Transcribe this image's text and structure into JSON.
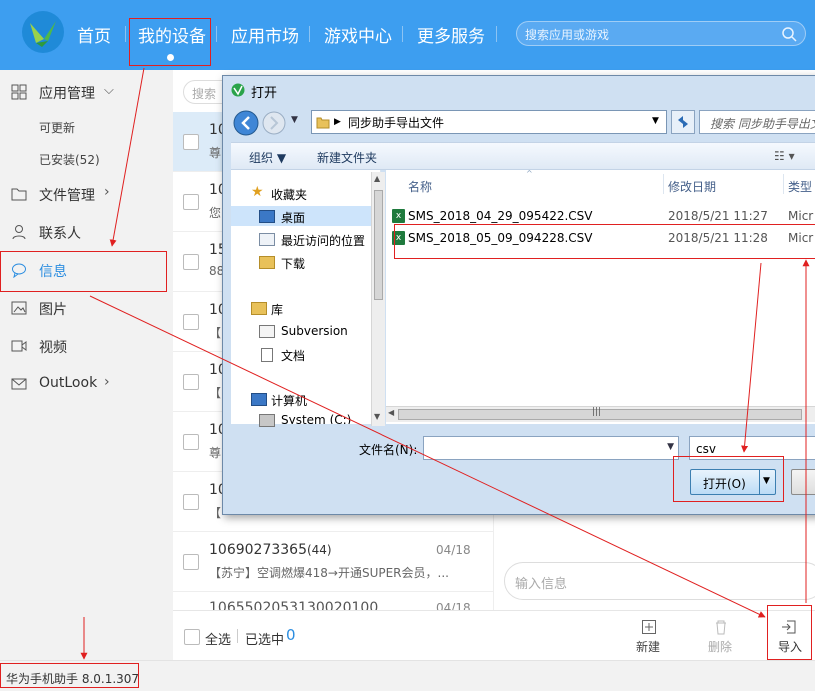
{
  "topnav": {
    "items": [
      "首页",
      "我的设备",
      "应用市场",
      "游戏中心",
      "更多服务"
    ],
    "search_placeholder": "搜索应用或游戏"
  },
  "sidebar": {
    "app_mgmt": "应用管理",
    "updatable": "可更新",
    "installed": "已安装(52)",
    "file_mgmt": "文件管理",
    "contacts": "联系人",
    "messages": "信息",
    "pictures": "图片",
    "videos": "视频",
    "outlook": "OutLook"
  },
  "list": {
    "search_placeholder": "搜索",
    "items": [
      {
        "num": "10",
        "preview": "尊"
      },
      {
        "num": "10",
        "preview": "您"
      },
      {
        "num": "15",
        "preview": "88"
      },
      {
        "num": "10",
        "preview": "【"
      },
      {
        "num": "10",
        "preview": "【"
      },
      {
        "num": "10",
        "preview": "尊"
      },
      {
        "num": "10",
        "preview": "【"
      },
      {
        "num": "10690273365",
        "count": "(44)",
        "date": "04/18",
        "preview": "【苏宁】空调燃爆418→开通SUPER会员，..."
      },
      {
        "num": "1065502053130020100",
        "count": "...",
        "date": "04/18",
        "preview": ""
      }
    ]
  },
  "detail": {
    "input_placeholder": "输入信息"
  },
  "bottom": {
    "select_all": "全选",
    "selected": "已选中",
    "selected_count": "0",
    "new": "新建",
    "delete": "删除",
    "import": "导入"
  },
  "status": {
    "version": "华为手机助手 8.0.1.307"
  },
  "dialog": {
    "title": "打开",
    "path": "同步助手导出文件",
    "search": "搜索 同步助手导出文",
    "organize": "组织 ▼",
    "new_folder": "新建文件夹",
    "nav": [
      "收藏夹",
      "桌面",
      "最近访问的位置",
      "下载",
      "库",
      "Subversion",
      "文档",
      "计算机",
      "System (C:)"
    ],
    "col_name": "名称",
    "col_date": "修改日期",
    "col_type": "类型",
    "files": [
      {
        "name": "SMS_2018_04_29_095422.CSV",
        "date": "2018/5/21 11:27",
        "type": "Micr"
      },
      {
        "name": "SMS_2018_05_09_094228.CSV",
        "date": "2018/5/21 11:28",
        "type": "Micr"
      }
    ],
    "filename_label": "文件名(N):",
    "filetype": "csv",
    "open": "打开(O)"
  },
  "colors": {
    "nav_blue": "#3d9ef0",
    "accent": "#2b8de0",
    "annotation_red": "#e02020"
  }
}
